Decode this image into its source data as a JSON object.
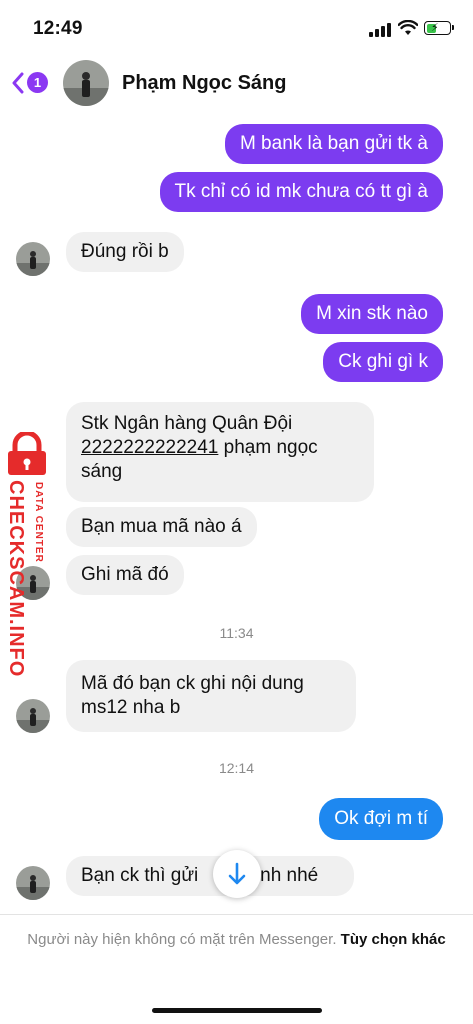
{
  "status_bar": {
    "time": "12:49",
    "battery_level": 0.45,
    "battery_color": "#3ac34b"
  },
  "header": {
    "unread_count": "1",
    "contact_name": "Phạm Ngọc Sáng",
    "accent_color": "#8b38f2"
  },
  "messages": [
    {
      "direction": "outgoing",
      "text": "M bank là bạn gửi tk à"
    },
    {
      "direction": "outgoing",
      "text": "Tk chỉ có id mk chưa có tt gì à"
    },
    {
      "direction": "incoming",
      "text": "Đúng rồi b"
    },
    {
      "direction": "outgoing",
      "text": "M xin stk nào"
    },
    {
      "direction": "outgoing",
      "text": "Ck ghi gì k"
    },
    {
      "direction": "incoming",
      "text_line1": "Stk Ngân hàng Quân Đội",
      "account_number": "2222222222241",
      "text_line2_suffix": " phạm ngọc",
      "text_line3": "sáng"
    },
    {
      "direction": "incoming",
      "text": "Bạn mua mã nào á"
    },
    {
      "direction": "incoming",
      "text": "Ghi mã đó"
    },
    {
      "type": "timestamp",
      "text": "11:34"
    },
    {
      "direction": "incoming",
      "text_line1": "Mã đó bạn ck ghi nội dung",
      "text_line2": "ms12 nha b"
    },
    {
      "type": "timestamp",
      "text": "12:14"
    },
    {
      "direction": "outgoing",
      "text": "Ok đợi m tí"
    },
    {
      "direction": "incoming",
      "text_part1": "Bạn ck thì gửi",
      "text_part2": "hình nhé"
    }
  ],
  "watermark": {
    "main": "CHECKSCAM.INFO",
    "sub": "DATA CENTER"
  },
  "footer": {
    "notice": "Người này hiện không có mặt trên Messenger.",
    "action": "Tùy chọn khác"
  },
  "colors": {
    "outgoing_bubble": "#7c3cf0",
    "incoming_bubble": "#f0f0f0",
    "last_outgoing_bubble": "#1e88f0",
    "watermark": "#e52b2b"
  },
  "icons": [
    "back-chevron-icon",
    "signal-icon",
    "wifi-icon",
    "battery-icon",
    "arrow-down-icon",
    "lock-icon"
  ]
}
